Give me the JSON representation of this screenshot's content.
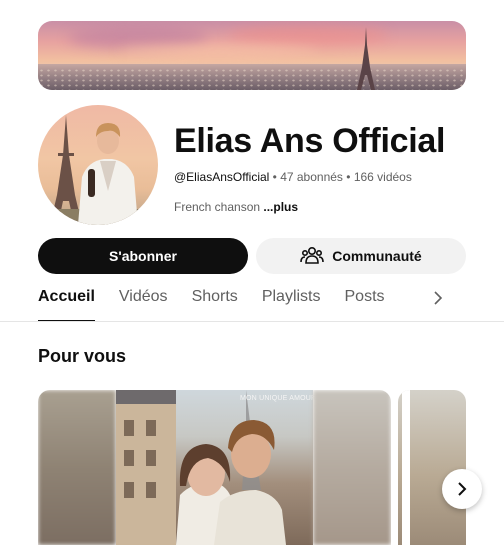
{
  "channel": {
    "name": "Elias Ans Official",
    "handle": "@EliasAnsOfficial",
    "subscribers": "47 abonnés",
    "videos": "166 vidéos",
    "separator": " • ",
    "description": "French chanson ",
    "more_label": "...plus"
  },
  "actions": {
    "subscribe_label": "S'abonner",
    "community_label": "Communauté"
  },
  "tabs": [
    {
      "label": "Accueil",
      "active": true
    },
    {
      "label": "Vidéos",
      "active": false
    },
    {
      "label": "Shorts",
      "active": false
    },
    {
      "label": "Playlists",
      "active": false
    },
    {
      "label": "Posts",
      "active": false
    }
  ],
  "section": {
    "title": "Pour vous",
    "video_caption": "MON UNIQUE AMOUR"
  },
  "icons": {
    "tabs_next": "chevron-right-icon",
    "community": "community-icon",
    "carousel_next": "chevron-right-icon"
  },
  "colors": {
    "accent": "#0f0f0f",
    "secondary_text": "#606060",
    "pill_bg": "#f2f2f2"
  }
}
